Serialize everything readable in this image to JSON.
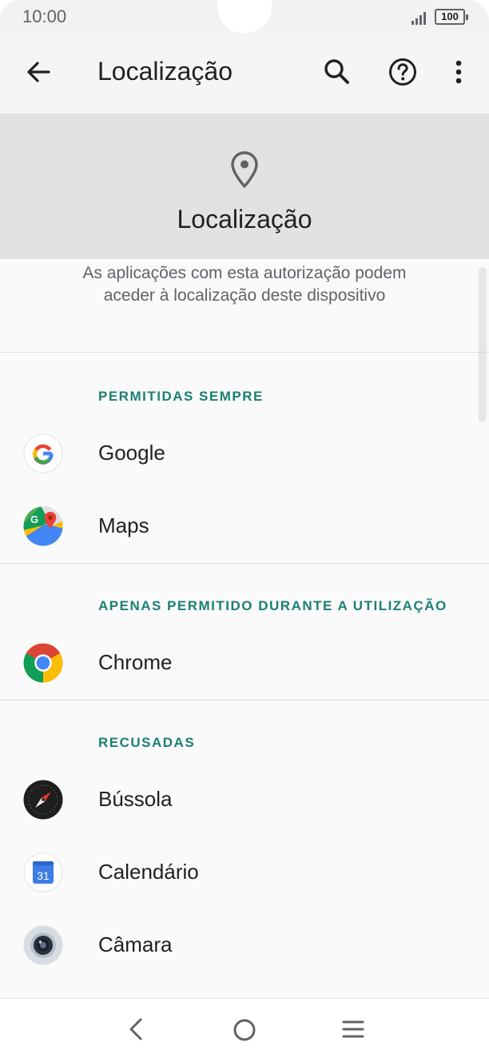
{
  "status_bar": {
    "time": "10:00",
    "battery": "100"
  },
  "app_bar": {
    "title": "Localização"
  },
  "header": {
    "title": "Localização",
    "description": "As aplicações com esta autorização podem aceder à localização deste dispositivo"
  },
  "sections": {
    "always": {
      "title": "PERMITIDAS SEMPRE",
      "apps": [
        {
          "label": "Google",
          "icon": "google-icon"
        },
        {
          "label": "Maps",
          "icon": "maps-icon"
        }
      ]
    },
    "while_using": {
      "title": "APENAS PERMITIDO DURANTE A UTILIZAÇÃO",
      "apps": [
        {
          "label": "Chrome",
          "icon": "chrome-icon"
        }
      ]
    },
    "denied": {
      "title": "RECUSADAS",
      "apps": [
        {
          "label": "Bússola",
          "icon": "compass-icon"
        },
        {
          "label": "Calendário",
          "icon": "calendar-icon",
          "icon_text": "31"
        },
        {
          "label": "Câmara",
          "icon": "camera-icon"
        }
      ]
    }
  },
  "colors": {
    "accent": "#1a8072",
    "header_band": "#e2e2e2",
    "background": "#fafafa"
  }
}
